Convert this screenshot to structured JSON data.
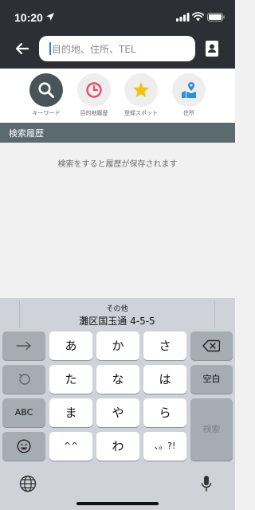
{
  "status_bar": {
    "time": "10:20"
  },
  "header": {
    "search_placeholder": "目的地、住所、TEL"
  },
  "categories": [
    {
      "label": "キーワード",
      "icon": "search-icon",
      "active": true
    },
    {
      "label": "目的地履歴",
      "icon": "history-clock-icon",
      "active": false
    },
    {
      "label": "登録スポット",
      "icon": "star-icon",
      "active": false
    },
    {
      "label": "住所",
      "icon": "map-pin-icon",
      "active": false
    }
  ],
  "history": {
    "title": "検索履歴",
    "empty_message": "検索をすると履歴が保存されます"
  },
  "keyboard": {
    "suggestion_caption": "その他",
    "suggestion_text": "灘区国玉通 4-5-5",
    "rows": [
      [
        "あ",
        "か",
        "さ"
      ],
      [
        "た",
        "な",
        "は"
      ],
      [
        "ま",
        "や",
        "ら"
      ],
      [
        "^^",
        "わ",
        "、。?!"
      ]
    ],
    "space_label": "空白",
    "search_label": "検索",
    "abc_label": "ABC"
  },
  "colors": {
    "header_bg": "#2e2f34",
    "active_category": "#485458",
    "history_header_bg": "#5b6a6e",
    "keyboard_bg": "#cfd2d8",
    "history_icon": "#e84a6b",
    "star_icon": "#f2c315",
    "pin_icon": "#2f8fd8"
  }
}
